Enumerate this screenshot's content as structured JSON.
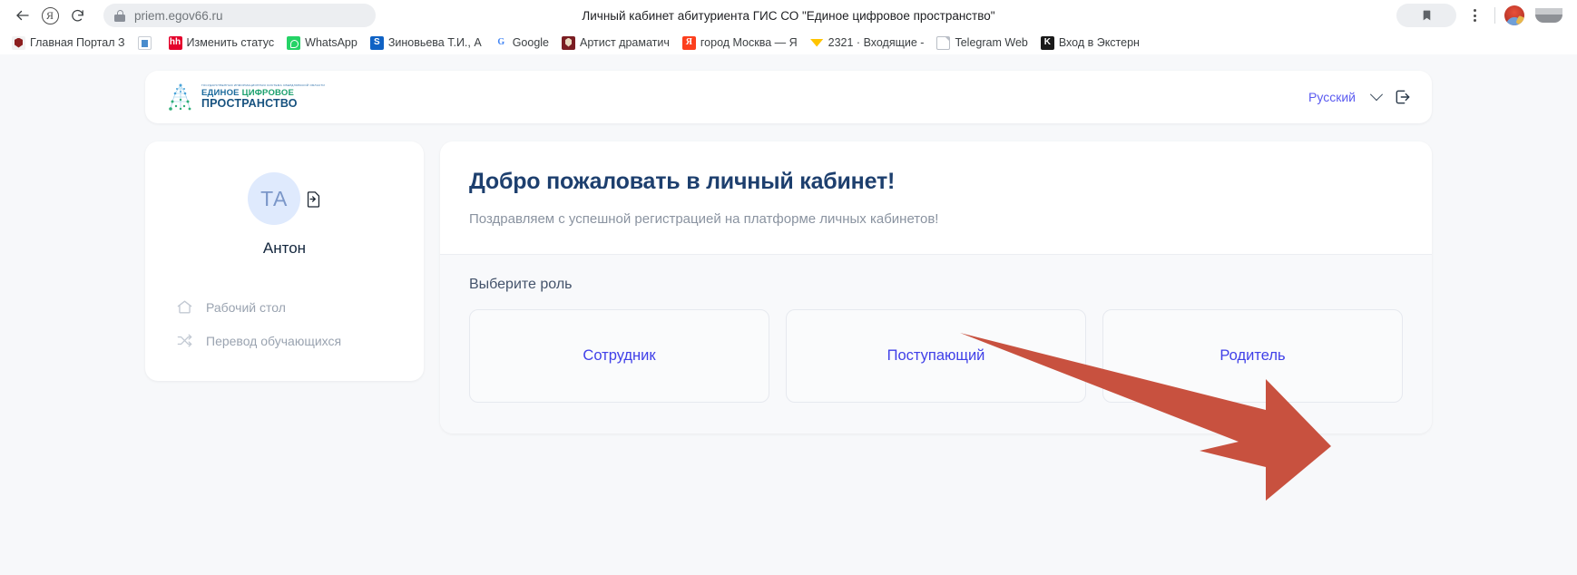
{
  "browser": {
    "back_tooltip": "Назад",
    "reload_tooltip": "Обновить",
    "url": "priem.egov66.ru",
    "tab_title": "Личный кабинет абитуриента ГИС СО \"Единое цифровое пространство\"",
    "bookmarks": [
      {
        "label": "Главная Портал З",
        "icon": "gerb-icon"
      },
      {
        "label": "",
        "icon": "document-icon"
      },
      {
        "label": "Изменить статус",
        "icon": "hh-icon"
      },
      {
        "label": "WhatsApp",
        "icon": "whatsapp-icon"
      },
      {
        "label": "Зиновьева Т.И., А",
        "icon": "sberbank-icon"
      },
      {
        "label": "Google",
        "icon": "google-icon"
      },
      {
        "label": "Артист драматич",
        "icon": "gerb-dark-icon"
      },
      {
        "label": "город Москва — Я",
        "icon": "yandex-icon"
      },
      {
        "label": "2321 · Входящие -",
        "icon": "mailru-icon"
      },
      {
        "label": "Telegram Web",
        "icon": "page-icon"
      },
      {
        "label": "Вход в Экстерн",
        "icon": "kontur-icon"
      }
    ]
  },
  "header": {
    "logo_top_line": "ГОСУДАРСТВЕННАЯ ИНФОРМАЦИОННАЯ СИСТЕМА СВЕРДЛОВСКОЙ ОБЛАСТИ",
    "logo_line1_a": "ЕДИНОЕ ",
    "logo_line1_b": "ЦИФРОВОЕ",
    "logo_line2": "ПРОСТРАНСТВО",
    "language": "Русский",
    "logout_label": "Выход"
  },
  "profile": {
    "avatar_initials": "ТА",
    "name": "Антон",
    "menu": [
      {
        "label": "Рабочий стол",
        "icon": "home-icon"
      },
      {
        "label": "Перевод обучающихся",
        "icon": "shuffle-icon"
      }
    ]
  },
  "main": {
    "welcome_title": "Добро пожаловать в личный кабинет!",
    "welcome_subtitle": "Поздравляем с успешной регистрацией на платформе личных кабинетов!",
    "roles_label": "Выберите роль",
    "roles": [
      {
        "label": "Сотрудник"
      },
      {
        "label": "Поступающий"
      },
      {
        "label": "Родитель"
      }
    ]
  },
  "annotation": {
    "arrow_color": "#c8513f",
    "arrow_target": "Родитель"
  },
  "colors": {
    "page_bg": "#f7f8fa",
    "card_bg": "#ffffff",
    "accent_blue": "#4040e8",
    "title_blue": "#1d3f6e",
    "lang_purple": "#5b5bf0",
    "muted_text": "#8a93a0"
  }
}
